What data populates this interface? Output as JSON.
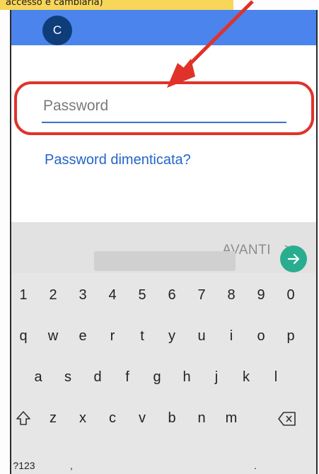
{
  "caption": {
    "text": "accesso e cambiarla)"
  },
  "appbar": {
    "avatar_letter": "C"
  },
  "login": {
    "password_placeholder": "Password",
    "forgot_link": "Password dimenticata?"
  },
  "keyboard": {
    "next_label": "AVANTI",
    "next_chevron": ">",
    "numbers": [
      "1",
      "2",
      "3",
      "4",
      "5",
      "6",
      "7",
      "8",
      "9",
      "0"
    ],
    "row1": [
      "q",
      "w",
      "e",
      "r",
      "t",
      "y",
      "u",
      "i",
      "o",
      "p"
    ],
    "row2": [
      "a",
      "s",
      "d",
      "f",
      "g",
      "h",
      "j",
      "k",
      "l"
    ],
    "row3": [
      "z",
      "x",
      "c",
      "v",
      "b",
      "n",
      "m"
    ],
    "symbols_key": "?123",
    "comma_key": ",",
    "period_key": "."
  },
  "colors": {
    "appbar": "#4a84ec",
    "link": "#2465c8",
    "highlight": "#e0322a",
    "enter": "#29ad8f",
    "caption_bg": "#f7d65a"
  },
  "icons": [
    "shift-icon",
    "backspace-icon",
    "arrow-right-icon",
    "red-arrow-annotation-icon"
  ]
}
